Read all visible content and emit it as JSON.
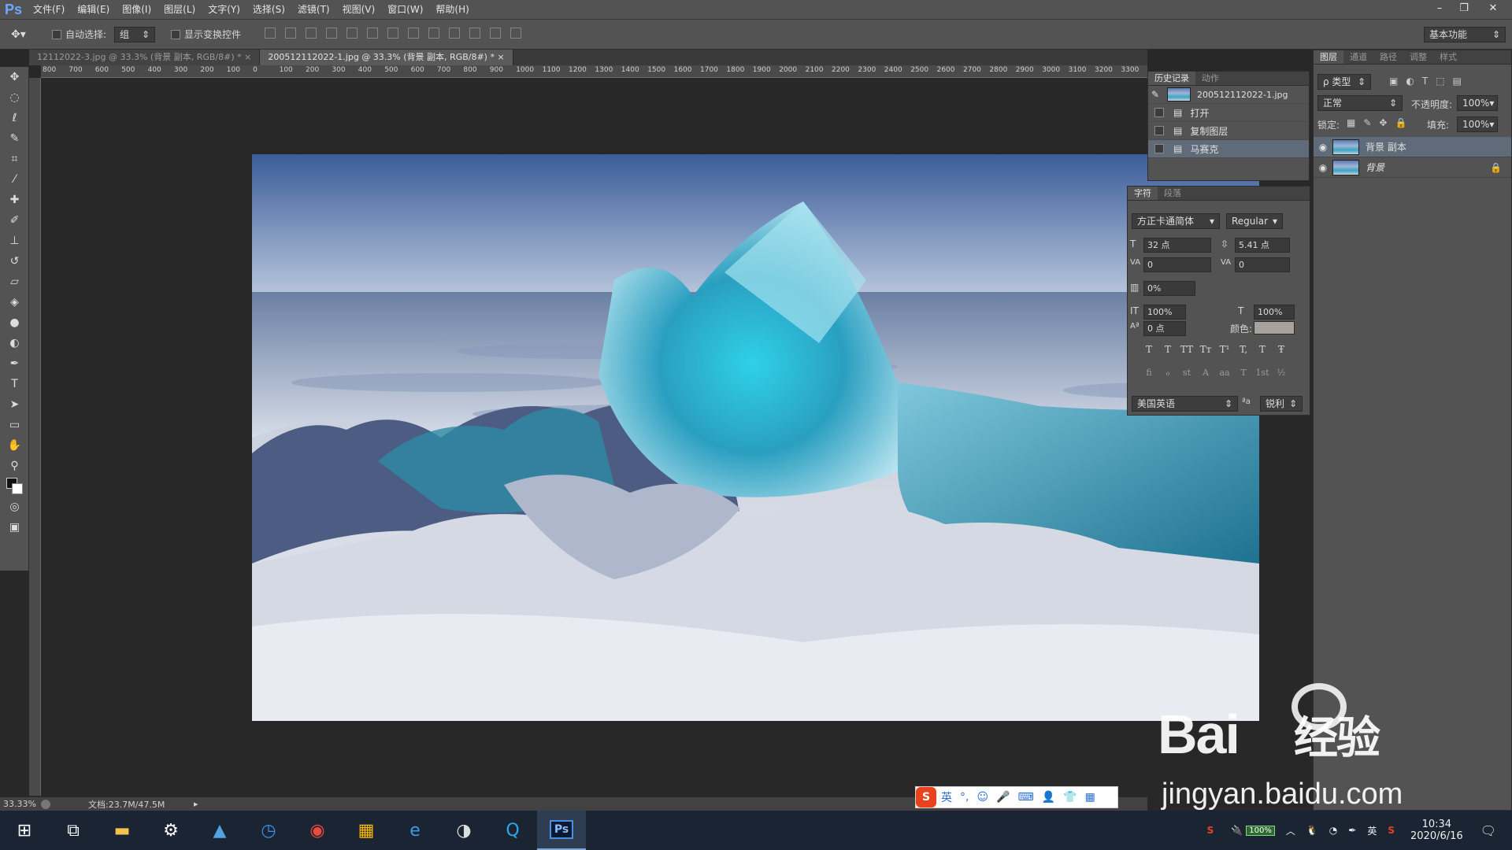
{
  "app": {
    "logo": "Ps"
  },
  "menu": [
    "文件(F)",
    "编辑(E)",
    "图像(I)",
    "图层(L)",
    "文字(Y)",
    "选择(S)",
    "滤镜(T)",
    "视图(V)",
    "窗口(W)",
    "帮助(H)"
  ],
  "window_controls": {
    "minimize": "–",
    "restore": "❐",
    "close": "✕"
  },
  "options": {
    "auto_select_label": "自动选择:",
    "auto_select_value": "组",
    "show_transform_label": "显示变换控件",
    "workspace": "基本功能"
  },
  "tabs": [
    {
      "label": "12112022-3.jpg @ 33.3% (背景 副本, RGB/8#) *"
    },
    {
      "label": "200512112022-1.jpg @ 33.3% (背景 副本, RGB/8#) *",
      "active": true,
      "close": "×"
    }
  ],
  "ruler_labels": [
    "800",
    "700",
    "600",
    "500",
    "400",
    "300",
    "200",
    "100",
    "0",
    "100",
    "200",
    "300",
    "400",
    "500",
    "600",
    "700",
    "800",
    "900",
    "1000",
    "1100",
    "1200",
    "1300",
    "1400",
    "1500",
    "1600",
    "1700",
    "1800",
    "1900",
    "2000",
    "2100",
    "2200",
    "2300",
    "2400",
    "2500",
    "2600",
    "2700",
    "2800",
    "2900",
    "3000",
    "3100",
    "3200",
    "3300"
  ],
  "status": {
    "zoom": "33.33%",
    "doc": "文档:23.7M/47.5M"
  },
  "history": {
    "tabs": [
      "历史记录",
      "动作"
    ],
    "snapshot": "200512112022-1.jpg",
    "items": [
      "打开",
      "复制图层",
      "马赛克"
    ],
    "selected_index": 2
  },
  "character": {
    "tabs": [
      "字符",
      "段落"
    ],
    "font": "方正卡通简体",
    "style": "Regular",
    "size": "32 点",
    "leading": "5.41 点",
    "kerning": "0",
    "tracking": "0",
    "scale_pct": "0%",
    "vscale": "100%",
    "hscale": "100%",
    "baseline": "0 点",
    "color_label": "颜色:",
    "color": "#a8a29c",
    "style_buttons": [
      "T",
      "T",
      "TT",
      "Tт",
      "T¹",
      "T,",
      "T",
      "Ŧ"
    ],
    "ot_buttons": [
      "fi",
      "ℴ",
      "st",
      "A",
      "aa",
      "T",
      "1st",
      "½"
    ],
    "language": "美国英语",
    "aa_label": "ªa",
    "antialias": "锐利"
  },
  "layers": {
    "tabs": [
      "图层",
      "通道",
      "路径",
      "调整",
      "样式"
    ],
    "filter": "ρ 类型",
    "blend": "正常",
    "opacity_label": "不透明度:",
    "opacity": "100%",
    "lock_label": "锁定:",
    "fill_label": "填充:",
    "fill": "100%",
    "items": [
      {
        "name": "背景 副本",
        "selected": true
      },
      {
        "name": "背景",
        "locked": true
      }
    ]
  },
  "ime": {
    "logo": "S",
    "mode": "英"
  },
  "taskbar": {
    "battery": "100%",
    "lang": "英",
    "time": "10:34",
    "date": "2020/6/16"
  },
  "watermark": {
    "brand": "Bai",
    "brand_suffix": "经验",
    "url": "jingyan.baidu.com"
  }
}
